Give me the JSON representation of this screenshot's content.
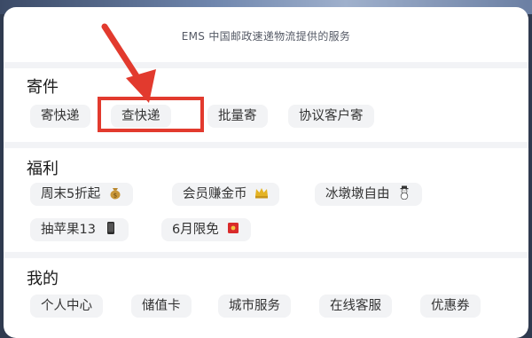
{
  "header": {
    "provider_text": "EMS 中国邮政速递物流提供的服务"
  },
  "sections": [
    {
      "title": "寄件",
      "items": [
        {
          "label": "寄快递"
        },
        {
          "label": "查快递"
        },
        {
          "label": "批量寄"
        },
        {
          "label": "协议客户寄"
        }
      ]
    },
    {
      "title": "福利",
      "items": [
        {
          "label": "周末5折起",
          "icon": "money-bag-icon"
        },
        {
          "label": "会员赚金币",
          "icon": "crown-icon"
        },
        {
          "label": "冰墩墩自由",
          "icon": "snowman-icon"
        },
        {
          "label": "抽苹果13",
          "icon": "phone-icon"
        },
        {
          "label": "6月限免",
          "icon": "red-envelope-icon"
        }
      ]
    },
    {
      "title": "我的",
      "items": [
        {
          "label": "个人中心"
        },
        {
          "label": "储值卡"
        },
        {
          "label": "城市服务"
        },
        {
          "label": "在线客服"
        },
        {
          "label": "优惠券"
        }
      ]
    }
  ],
  "annotation": {
    "highlighted_item": "查快递",
    "color": "#e23a2e"
  }
}
